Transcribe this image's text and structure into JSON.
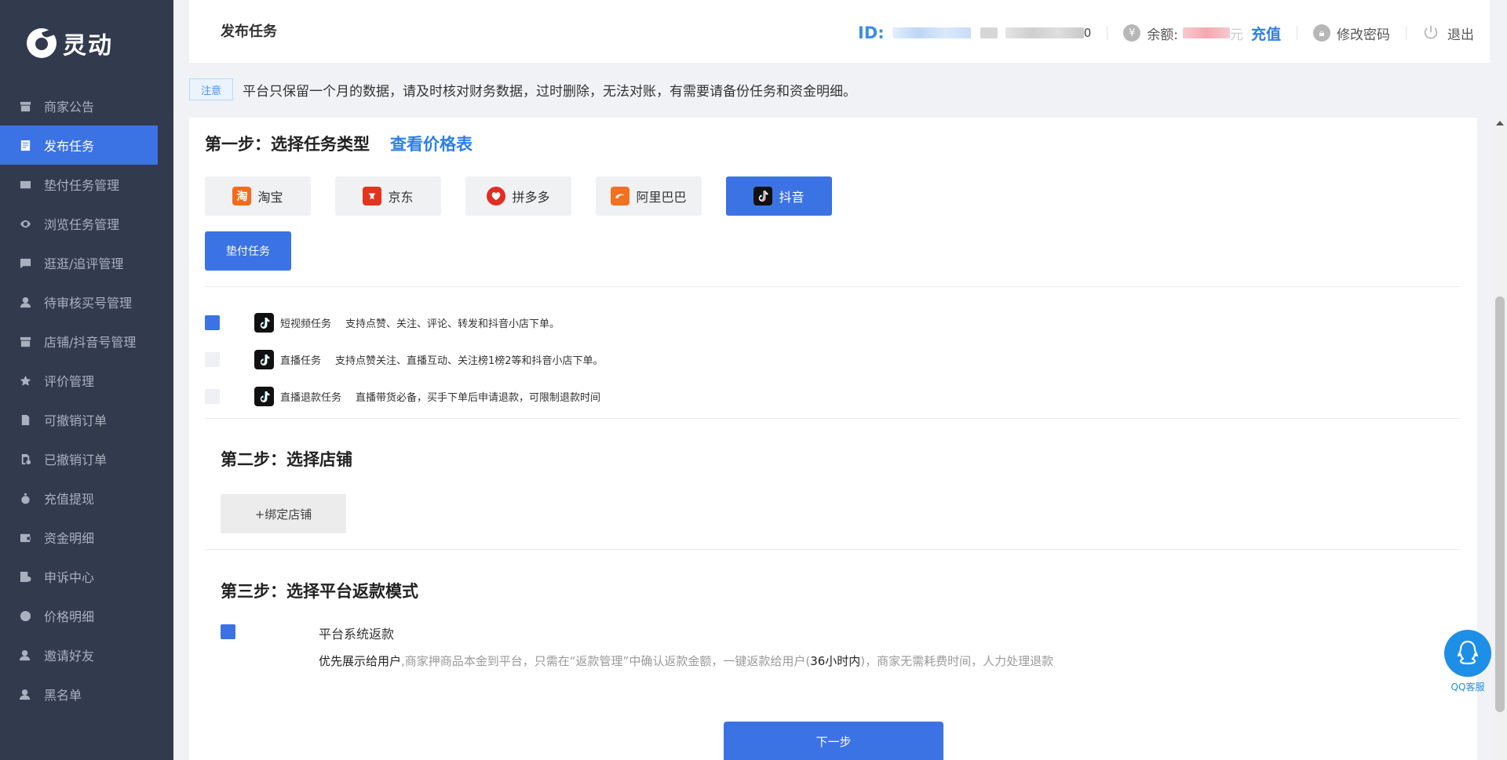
{
  "brand": {
    "name": "灵动"
  },
  "sidebar": {
    "items": [
      {
        "label": "商家公告",
        "icon": "store-icon"
      },
      {
        "label": "发布任务",
        "icon": "document-icon",
        "active": true
      },
      {
        "label": "垫付任务管理",
        "icon": "card-icon"
      },
      {
        "label": "浏览任务管理",
        "icon": "eye-icon"
      },
      {
        "label": "逛逛/追评管理",
        "icon": "comment-icon"
      },
      {
        "label": "待审核买号管理",
        "icon": "user-icon"
      },
      {
        "label": "店铺/抖音号管理",
        "icon": "shop-icon"
      },
      {
        "label": "评价管理",
        "icon": "star-icon"
      },
      {
        "label": "可撤销订单",
        "icon": "file-icon"
      },
      {
        "label": "已撤销订单",
        "icon": "file-check-icon"
      },
      {
        "label": "充值提现",
        "icon": "money-bag-icon"
      },
      {
        "label": "资金明细",
        "icon": "wallet-icon"
      },
      {
        "label": "申诉中心",
        "icon": "appeal-icon"
      },
      {
        "label": "价格明细",
        "icon": "yen-icon"
      },
      {
        "label": "邀请好友",
        "icon": "invite-icon"
      },
      {
        "label": "黑名单",
        "icon": "blacklist-icon"
      }
    ]
  },
  "header": {
    "title": "发布任务",
    "id_label": "ID:",
    "id_tail": "0",
    "balance_label": "余额:",
    "balance_tail": "元",
    "recharge": "充值",
    "change_password": "修改密码",
    "logout": "退出"
  },
  "notice": {
    "tag": "注意",
    "text": "平台只保留一个月的数据，请及时核对财务数据，过时删除，无法对账，有需要请备份任务和资金明细。"
  },
  "step1": {
    "title": "第一步：选择任务类型",
    "price_link": "查看价格表",
    "platforms": [
      {
        "label": "淘宝",
        "icon": "taobao-icon",
        "glyph": "淘"
      },
      {
        "label": "京东",
        "icon": "jd-icon",
        "glyph": ""
      },
      {
        "label": "拼多多",
        "icon": "pinduoduo-icon",
        "glyph": ""
      },
      {
        "label": "阿里巴巴",
        "icon": "alibaba-icon",
        "glyph": ""
      },
      {
        "label": "抖音",
        "icon": "douyin-icon",
        "glyph": "",
        "active": true
      }
    ],
    "advance_button": "垫付任务",
    "tasks": [
      {
        "name": "短视频任务",
        "desc": "支持点赞、关注、评论、转发和抖音小店下单。",
        "checked": true
      },
      {
        "name": "直播任务",
        "desc": "支持点赞关注、直播互动、关注榜1榜2等和抖音小店下单。",
        "checked": false
      },
      {
        "name": "直播退款任务",
        "desc": "直播带货必备，买手下单后申请退款，可限制退款时间",
        "checked": false
      }
    ]
  },
  "step2": {
    "title": "第二步：选择店铺",
    "bind_button": "+绑定店铺"
  },
  "step3": {
    "title": "第三步：选择平台返款模式",
    "option_title": "平台系统返款",
    "desc_strong": "优先展示给用户",
    "desc_part1": ",商家押商品本金到平台，只需在“返款管理”中确认返款金额，一键返款给用户(",
    "desc_hours": "36小时内",
    "desc_part2": ")，商家无需耗费时间，人力处理退款"
  },
  "next_button": "下一步",
  "qq": {
    "label": "QQ客服"
  },
  "colors": {
    "primary": "#3b73e4",
    "sidebar": "#323a4e",
    "link": "#2d7ee6"
  }
}
